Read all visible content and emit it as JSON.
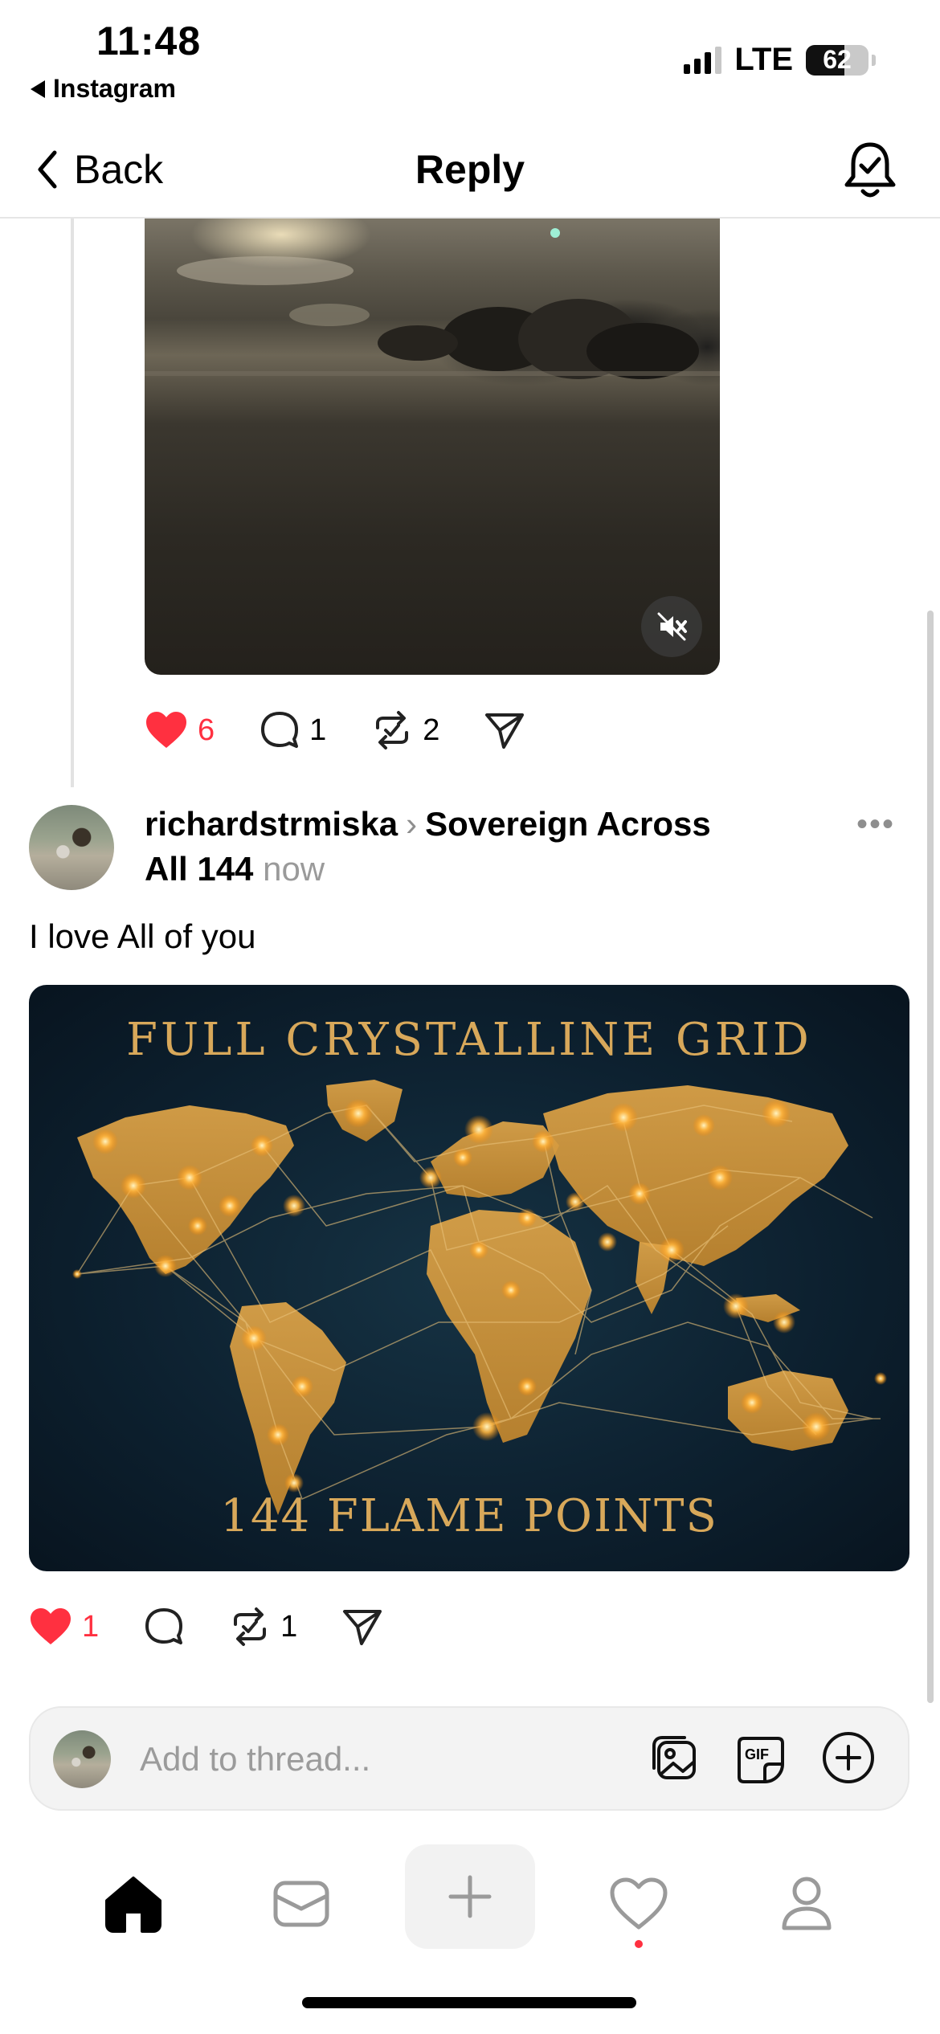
{
  "status_bar": {
    "time": "11:48",
    "back_app": "Instagram",
    "network": "LTE",
    "battery": "62"
  },
  "nav": {
    "back_label": "Back",
    "title": "Reply"
  },
  "first_post": {
    "likes": "6",
    "comments": "1",
    "reposts": "2"
  },
  "post": {
    "username": "richardstrmiska",
    "community_line1": "Sovereign Across",
    "community_line2": "All 144",
    "timestamp": "now",
    "more": "•••",
    "text": "I love All of you",
    "image": {
      "title": "FULL CRYSTALLINE GRID",
      "subtitle": "144 FLAME POINTS"
    },
    "likes": "1",
    "reposts": "1"
  },
  "composer": {
    "placeholder": "Add to thread...",
    "gif_label": "GIF"
  },
  "colors": {
    "like_red": "#ff3040",
    "map_gold": "#d8a85a",
    "map_bg": "#0d2130"
  }
}
